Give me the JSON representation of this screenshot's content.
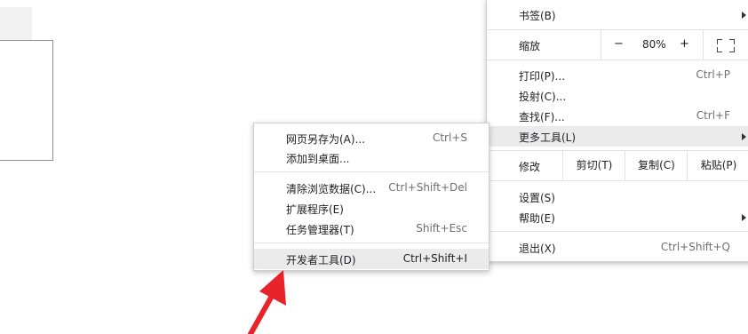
{
  "main_menu": {
    "bookmarks": "书签(B)",
    "zoom_label": "缩放",
    "zoom_minus": "−",
    "zoom_value": "80%",
    "zoom_plus": "+",
    "print": "打印(P)...",
    "print_shortcut": "Ctrl+P",
    "cast": "投射(C)...",
    "find": "查找(F)...",
    "find_shortcut": "Ctrl+F",
    "more_tools": "更多工具(L)",
    "edit_label": "修改",
    "cut": "剪切(T)",
    "copy": "复制(C)",
    "paste": "粘贴(P)",
    "settings": "设置(S)",
    "help": "帮助(E)",
    "exit": "退出(X)",
    "exit_shortcut": "Ctrl+Shift+Q"
  },
  "sub_menu": {
    "save_page": "网页另存为(A)...",
    "save_page_shortcut": "Ctrl+S",
    "add_to_desktop": "添加到桌面...",
    "clear_data": "清除浏览数据(C)...",
    "clear_data_shortcut": "Ctrl+Shift+Del",
    "extensions": "扩展程序(E)",
    "task_manager": "任务管理器(T)",
    "task_manager_shortcut": "Shift+Esc",
    "devtools": "开发者工具(D)",
    "devtools_shortcut": "Ctrl+Shift+I"
  },
  "colors": {
    "highlight": "#ebebeb",
    "annotation_arrow": "#e8232a"
  }
}
